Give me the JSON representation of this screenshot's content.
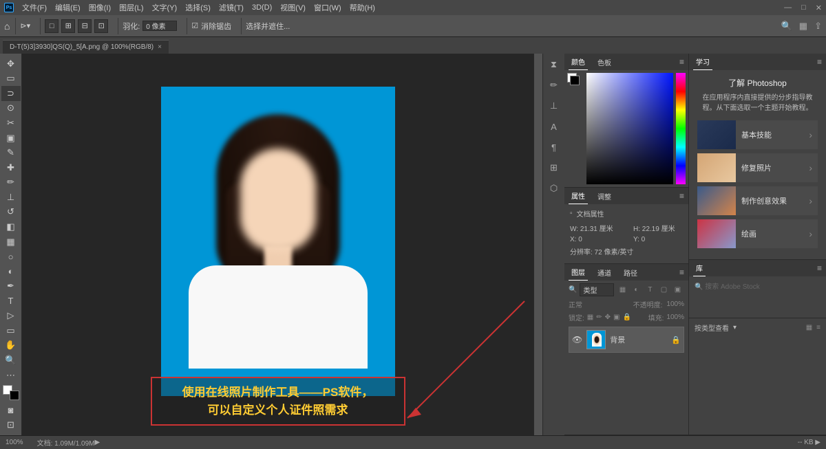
{
  "menubar": {
    "items": [
      "文件(F)",
      "编辑(E)",
      "图像(I)",
      "图层(L)",
      "文字(Y)",
      "选择(S)",
      "滤镜(T)",
      "3D(D)",
      "视图(V)",
      "窗口(W)",
      "帮助(H)"
    ]
  },
  "optionsbar": {
    "feather_label": "羽化:",
    "feather_value": "0 像素",
    "antialias": "消除锯齿",
    "style_label": "选择并遮住..."
  },
  "tab": {
    "title": "D-T(5)3]3930]QS(Q)_5[A.png @ 100%(RGB/8)",
    "close": "×"
  },
  "caption": {
    "line1": "使用在线照片制作工具——PS软件，",
    "line2": "可以自定义个人证件照需求"
  },
  "panels": {
    "color_tab": "颜色",
    "swatches_tab": "色板",
    "learn_tab": "学习",
    "learn_title": "了解 Photoshop",
    "learn_desc": "在应用程序内直接提供的分步指导教程。从下面选取一个主题开始教程。",
    "learn_items": [
      "基本技能",
      "修复照片",
      "制作创意效果",
      "绘画"
    ],
    "props_tab": "属性",
    "adjust_tab": "调整",
    "props_title": "文档属性",
    "props_w": "W: 21.31 厘米",
    "props_h": "H: 22.19 厘米",
    "props_x": "X: 0",
    "props_y": "Y: 0",
    "props_res": "分辨率: 72 像素/英寸",
    "lib_tab": "库",
    "lib_search": "搜索 Adobe Stock",
    "lib_row": "按类型查看",
    "layers_tab": "图层",
    "channels_tab": "通道",
    "paths_tab": "路径",
    "layers_kind": "类型",
    "layers_normal": "正常",
    "layers_opacity_label": "不透明度:",
    "layers_opacity": "100%",
    "layers_lock": "锁定:",
    "layers_fill_label": "填充:",
    "layers_fill": "100%",
    "layer_name": "背景"
  },
  "statusbar": {
    "zoom": "100%",
    "docinfo": "文档: 1.09M/1.09M",
    "right": "-- KB ▶"
  }
}
